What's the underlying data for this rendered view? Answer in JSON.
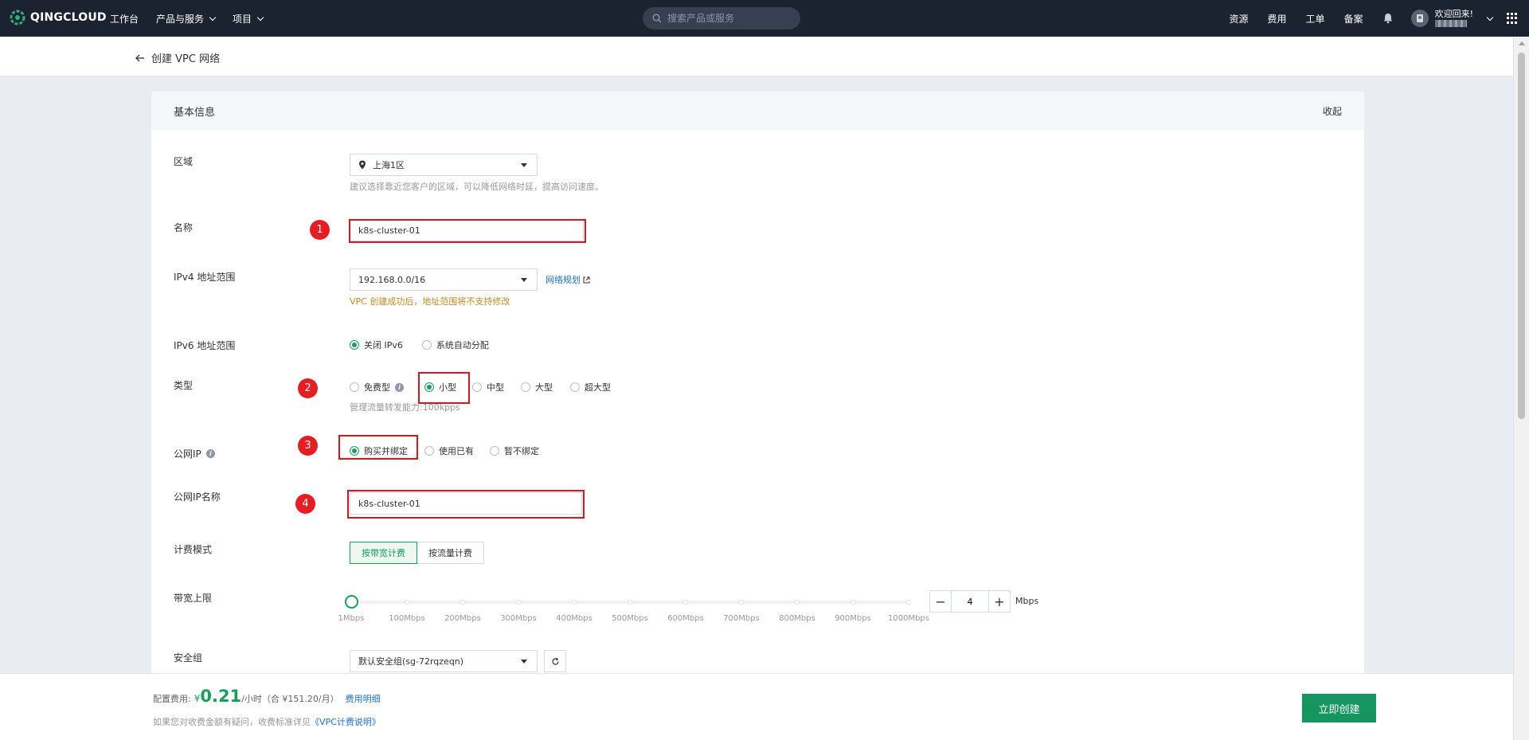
{
  "topbar": {
    "brand": "QINGCLOUD",
    "nav": [
      "工作台",
      "产品与服务",
      "项目"
    ],
    "search_placeholder": "搜索产品或服务",
    "links": [
      "资源",
      "费用",
      "工单",
      "备案"
    ],
    "welcome": "欢迎回来!"
  },
  "header": {
    "title": "创建 VPC 网络"
  },
  "card": {
    "section_title": "基本信息",
    "collapse": "收起",
    "region": {
      "label": "区域",
      "value": "上海1区",
      "hint": "建议选择靠近您客户的区域，可以降低网络时延，提高访问速度。"
    },
    "name": {
      "label": "名称",
      "value": "k8s-cluster-01"
    },
    "ipv4": {
      "label": "IPv4 地址范围",
      "value": "192.168.0.0/16",
      "link": "网络规划",
      "warning": "VPC 创建成功后，地址范围将不支持修改"
    },
    "ipv6": {
      "label": "IPv6 地址范围",
      "options": [
        "关闭 IPv6",
        "系统自动分配"
      ],
      "selected": 0
    },
    "type": {
      "label": "类型",
      "options": [
        "免费型",
        "小型",
        "中型",
        "大型",
        "超大型"
      ],
      "selected": 1,
      "hint": "管理流量转发能力:100kpps"
    },
    "public_ip": {
      "label": "公网IP",
      "options": [
        "购买并绑定",
        "使用已有",
        "暂不绑定"
      ],
      "selected": 0
    },
    "public_ip_name": {
      "label": "公网IP名称",
      "value": "k8s-cluster-01"
    },
    "billing": {
      "label": "计费模式",
      "options": [
        "按带宽计费",
        "按流量计费"
      ],
      "selected": 0
    },
    "bandwidth": {
      "label": "带宽上限",
      "ticks": [
        "1Mbps",
        "100Mbps",
        "200Mbps",
        "300Mbps",
        "400Mbps",
        "500Mbps",
        "600Mbps",
        "700Mbps",
        "800Mbps",
        "900Mbps",
        "1000Mbps"
      ],
      "value": "4",
      "unit": "Mbps",
      "minus": "−",
      "plus": "+"
    },
    "security_group": {
      "label": "安全组",
      "value": "默认安全组(sg-72rqzeqn)"
    }
  },
  "annotations": [
    "1",
    "2",
    "3",
    "4"
  ],
  "footer": {
    "price_label": "配置费用:",
    "currency": "¥",
    "amount": "0.21",
    "per": "/小时（合 ¥151.20/月）",
    "detail_link": "费用明细",
    "note": "如果您对收费金额有疑问，收费标准详见",
    "note_link": "《VPC计费说明》",
    "create": "立即创建"
  },
  "colors": {
    "accent": "#18a058",
    "topbar": "#1c2330",
    "annotation": "#e0121d",
    "link": "#1f6fd1"
  }
}
